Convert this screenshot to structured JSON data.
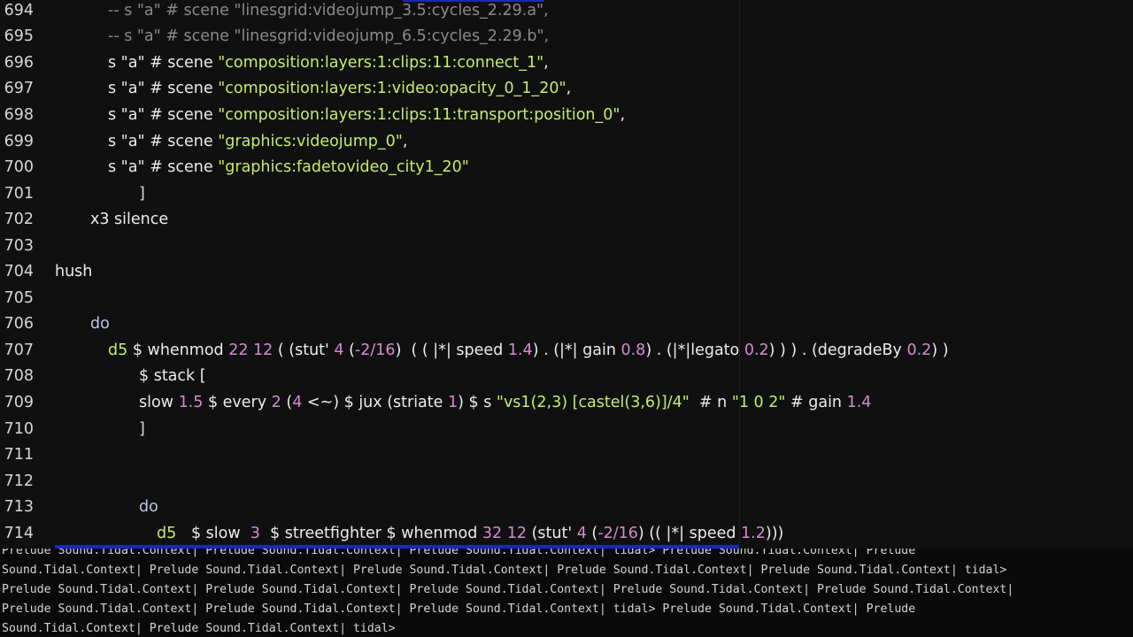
{
  "editor": {
    "lines": [
      {
        "n": "694",
        "segs": [
          {
            "t": "-- s \"a\" # scene \"linesgrid:videojump_3.5:cycles_2.29.a\",",
            "c": "comment"
          }
        ]
      },
      {
        "n": "695",
        "segs": [
          {
            "t": "-- s \"a\" # scene \"linesgrid:videojump_6.5:cycles_2.29.b\",",
            "c": "comment"
          }
        ]
      },
      {
        "n": "696",
        "segs": [
          {
            "t": "s \"a\" # scene ",
            "c": "white"
          },
          {
            "t": "\"composition:layers:1:clips:11:connect_1\"",
            "c": "str"
          },
          {
            "t": ",",
            "c": "white"
          }
        ]
      },
      {
        "n": "697",
        "segs": [
          {
            "t": "s \"a\" # scene ",
            "c": "white"
          },
          {
            "t": "\"composition:layers:1:video:opacity_0_1_20\"",
            "c": "str"
          },
          {
            "t": ",",
            "c": "white"
          }
        ]
      },
      {
        "n": "698",
        "segs": [
          {
            "t": "s \"a\" # scene ",
            "c": "white"
          },
          {
            "t": "\"composition:layers:1:clips:11:transport:position_0\"",
            "c": "str"
          },
          {
            "t": ",",
            "c": "white"
          }
        ]
      },
      {
        "n": "699",
        "segs": [
          {
            "t": "s \"a\" # scene ",
            "c": "white"
          },
          {
            "t": "\"graphics:videojump_0\"",
            "c": "str"
          },
          {
            "t": ",",
            "c": "white"
          }
        ]
      },
      {
        "n": "700",
        "segs": [
          {
            "t": "s \"a\" # scene ",
            "c": "white"
          },
          {
            "t": "\"graphics:fadetovideo_city1_20\"",
            "c": "str"
          }
        ]
      },
      {
        "n": "701",
        "segs": [
          {
            "t": "]",
            "c": "brk"
          }
        ]
      },
      {
        "n": "702",
        "segs": [
          {
            "t": "x3 silence",
            "c": "white"
          }
        ]
      },
      {
        "n": "703",
        "segs": []
      },
      {
        "n": "704",
        "segs": [
          {
            "t": "hush",
            "c": "white"
          }
        ]
      },
      {
        "n": "705",
        "segs": []
      },
      {
        "n": "706",
        "segs": [
          {
            "t": "do",
            "c": "kw"
          }
        ]
      },
      {
        "n": "707",
        "segs": [
          {
            "t": "d5",
            "c": "str"
          },
          {
            "t": " $ whenmod ",
            "c": "white"
          },
          {
            "t": "22 12",
            "c": "num"
          },
          {
            "t": " ( (stut' ",
            "c": "white"
          },
          {
            "t": "4",
            "c": "num"
          },
          {
            "t": " (",
            "c": "white"
          },
          {
            "t": "-2/16",
            "c": "num"
          },
          {
            "t": ")  ( ( |*| speed ",
            "c": "white"
          },
          {
            "t": "1.4",
            "c": "num"
          },
          {
            "t": ") . (|*| gain ",
            "c": "white"
          },
          {
            "t": "0.8",
            "c": "num"
          },
          {
            "t": ") . (|*|legato ",
            "c": "white"
          },
          {
            "t": "0.2",
            "c": "num"
          },
          {
            "t": ") ) ) . (degradeBy ",
            "c": "white"
          },
          {
            "t": "0.2",
            "c": "num"
          },
          {
            "t": ") )",
            "c": "white"
          }
        ]
      },
      {
        "n": "708",
        "segs": [
          {
            "t": "$ stack [",
            "c": "white"
          }
        ]
      },
      {
        "n": "709",
        "segs": [
          {
            "t": "slow ",
            "c": "white"
          },
          {
            "t": "1.5",
            "c": "num"
          },
          {
            "t": " $ every ",
            "c": "white"
          },
          {
            "t": "2",
            "c": "num"
          },
          {
            "t": " (",
            "c": "white"
          },
          {
            "t": "4",
            "c": "num"
          },
          {
            "t": " <~) $ jux (striate ",
            "c": "white"
          },
          {
            "t": "1",
            "c": "num"
          },
          {
            "t": ") $ s ",
            "c": "white"
          },
          {
            "t": "\"vs1(2,3) [castel(3,6)]/4\"",
            "c": "str"
          },
          {
            "t": "  # n ",
            "c": "white"
          },
          {
            "t": "\"1 0 2\"",
            "c": "str"
          },
          {
            "t": " # gain ",
            "c": "white"
          },
          {
            "t": "1.4",
            "c": "num"
          }
        ]
      },
      {
        "n": "710",
        "segs": [
          {
            "t": "]",
            "c": "brk"
          }
        ]
      },
      {
        "n": "711",
        "segs": []
      },
      {
        "n": "712",
        "segs": []
      },
      {
        "n": "713",
        "segs": [
          {
            "t": "do",
            "c": "kw"
          }
        ]
      },
      {
        "n": "714",
        "segs": [
          {
            "t": "d5",
            "c": "str"
          },
          {
            "t": "   $ slow  ",
            "c": "white"
          },
          {
            "t": "3",
            "c": "num"
          },
          {
            "t": "  $ streetfighter $ whenmod ",
            "c": "white"
          },
          {
            "t": "32 12",
            "c": "num"
          },
          {
            "t": " (stut' ",
            "c": "white"
          },
          {
            "t": "4",
            "c": "num"
          },
          {
            "t": " (",
            "c": "white"
          },
          {
            "t": "-2/16",
            "c": "num"
          },
          {
            "t": ") (( |*| speed ",
            "c": "white"
          },
          {
            "t": "1.2",
            "c": "num"
          },
          {
            "t": ")))",
            "c": "white"
          }
        ]
      }
    ]
  },
  "terminal": {
    "lines": [
      "Prelude Sound.Tidal.Context| Prelude Sound.Tidal.Context| Prelude Sound.Tidal.Context| tidal> Prelude Sound.Tidal.Context| Prelude",
      "Sound.Tidal.Context| Prelude Sound.Tidal.Context| Prelude Sound.Tidal.Context| Prelude Sound.Tidal.Context| Prelude Sound.Tidal.Context| tidal>",
      "Prelude Sound.Tidal.Context| Prelude Sound.Tidal.Context| Prelude Sound.Tidal.Context| Prelude Sound.Tidal.Context| Prelude Sound.Tidal.Context|",
      "Prelude Sound.Tidal.Context| Prelude Sound.Tidal.Context| Prelude Sound.Tidal.Context| tidal> Prelude Sound.Tidal.Context| Prelude",
      "Sound.Tidal.Context| Prelude Sound.Tidal.Context| tidal>"
    ]
  }
}
